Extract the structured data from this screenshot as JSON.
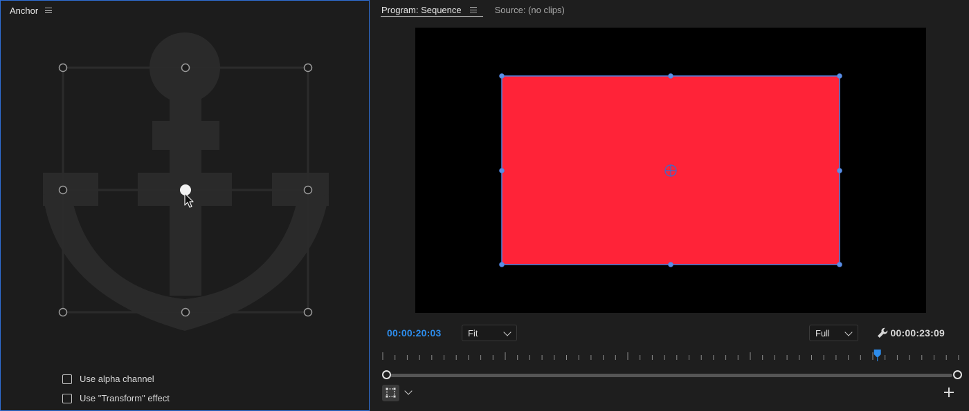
{
  "anchor_panel": {
    "title": "Anchor",
    "options": [
      {
        "label": "Use alpha channel",
        "checked": false
      },
      {
        "label": "Use \"Transform\" effect",
        "checked": false
      }
    ]
  },
  "program_monitor": {
    "tabs": [
      {
        "label": "Program: Sequence",
        "active": true,
        "has_menu": true
      },
      {
        "label": "Source: (no clips)",
        "active": false,
        "has_menu": false
      }
    ],
    "current_timecode": "00:00:20:03",
    "total_duration": "00:00:23:09",
    "zoom_select": "Fit",
    "resolution_select": "Full",
    "clip_color": "#ff2338",
    "accent_color": "#2d8ceb",
    "playhead_fraction": 0.858
  }
}
